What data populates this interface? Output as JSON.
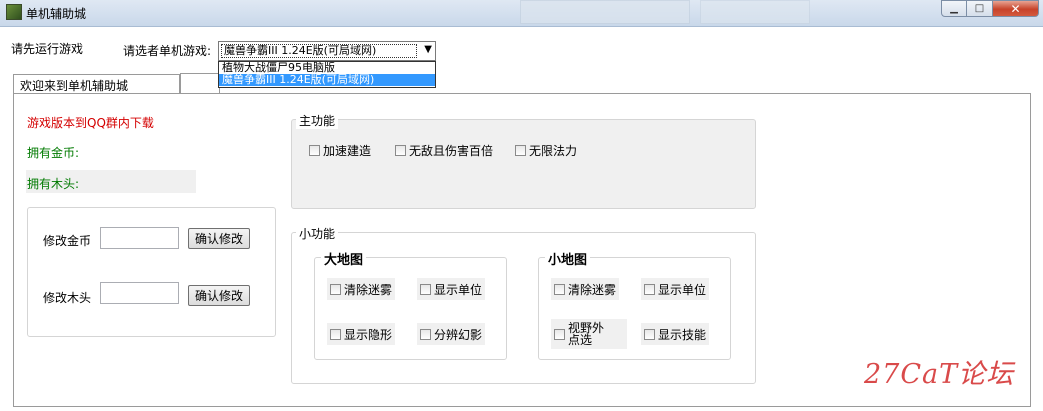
{
  "window": {
    "title": "单机辅助城",
    "close_glyph": "✕",
    "min_glyph": "▁",
    "max_glyph": "□"
  },
  "top": {
    "run_first_label": "请先运行游戏",
    "select_label": "请选者单机游戏:",
    "selected_game": "魔兽争霸III 1.24E版(可局域网)",
    "dropdown_arrow": "▼",
    "options": [
      "植物大战僵尸95电脑版",
      "魔兽争霸III 1.24E版(可局域网)"
    ]
  },
  "tabs": {
    "active": "欢迎来到单机辅助城",
    "other": ""
  },
  "left": {
    "download_note": "游戏版本到QQ群内下载",
    "gold_label": "拥有金币:",
    "wood_label": "拥有木头:",
    "modify_gold_label": "修改金币",
    "modify_wood_label": "修改木头",
    "confirm_label": "确认修改",
    "gold_value": "",
    "wood_value": ""
  },
  "main_features": {
    "title": "主功能",
    "items": [
      "加速建造",
      "无敌且伤害百倍",
      "无限法力"
    ]
  },
  "small_features": {
    "title": "小功能",
    "big_map": {
      "title": "大地图",
      "items": [
        "清除迷雾",
        "显示单位",
        "显示隐形",
        "分辨幻影"
      ]
    },
    "small_map": {
      "title": "小地图",
      "items": [
        "清除迷雾",
        "显示单位",
        "视野外点选",
        "显示技能"
      ]
    }
  },
  "watermark": "27CaT论坛"
}
